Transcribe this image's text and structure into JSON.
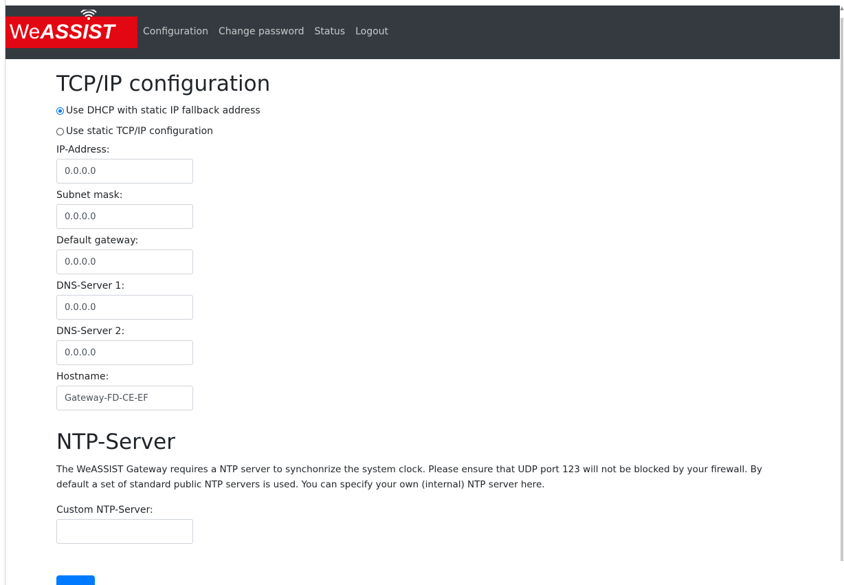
{
  "brand": {
    "we": "We",
    "assist": "ASSIST",
    "color": "#e30613"
  },
  "nav": {
    "background": "#343a40",
    "links": [
      {
        "label": "Configuration"
      },
      {
        "label": "Change password"
      },
      {
        "label": "Status"
      },
      {
        "label": "Logout"
      }
    ]
  },
  "tcpip": {
    "title": "TCP/IP configuration",
    "options": [
      {
        "label": "Use DHCP with static IP fallback address",
        "selected": true
      },
      {
        "label": "Use static TCP/IP configuration",
        "selected": false
      }
    ],
    "fields": {
      "ip_address": {
        "label": "IP-Address:",
        "value": "0.0.0.0"
      },
      "subnet_mask": {
        "label": "Subnet mask:",
        "value": "0.0.0.0"
      },
      "default_gateway": {
        "label": "Default gateway:",
        "value": "0.0.0.0"
      },
      "dns_server_1": {
        "label": "DNS-Server 1:",
        "value": "0.0.0.0"
      },
      "dns_server_2": {
        "label": "DNS-Server 2:",
        "value": "0.0.0.0"
      },
      "hostname": {
        "label": "Hostname:",
        "value": "Gateway-FD-CE-EF"
      }
    }
  },
  "ntp": {
    "title": "NTP-Server",
    "description": "The WeASSIST Gateway requires a NTP server to synchonrize the system clock. Please ensure that UDP port 123 will not be blocked by your firewall. By default a set of standard public NTP servers is used. You can specify your own (internal) NTP server here.",
    "custom_label": "Custom NTP-Server:",
    "custom_value": ""
  },
  "accent_color": "#007bff"
}
